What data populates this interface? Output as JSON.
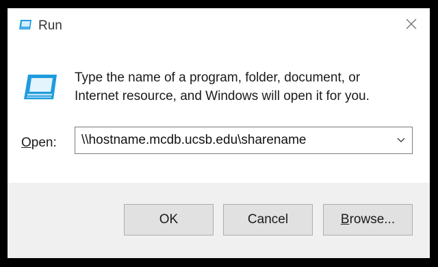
{
  "window": {
    "title": "Run",
    "title_icon": "run-icon",
    "close_icon": "close-icon"
  },
  "main": {
    "icon": "run-icon",
    "description_line1": "Type the name of a program, folder, document, or",
    "description_line2": "Internet resource, and Windows will open it for you.",
    "open_label_mnemonic": "O",
    "open_label_rest": "pen:",
    "open_value": "\\\\hostname.mcdb.ucsb.edu\\sharename",
    "dropdown_icon": "chevron-down-icon"
  },
  "buttons": {
    "ok": "OK",
    "cancel": "Cancel",
    "browse_mnemonic": "B",
    "browse_rest": "rowse..."
  },
  "colors": {
    "icon_blue": "#1f9bde",
    "footer_bg": "#f0f0f0",
    "button_bg": "#e1e1e1"
  }
}
